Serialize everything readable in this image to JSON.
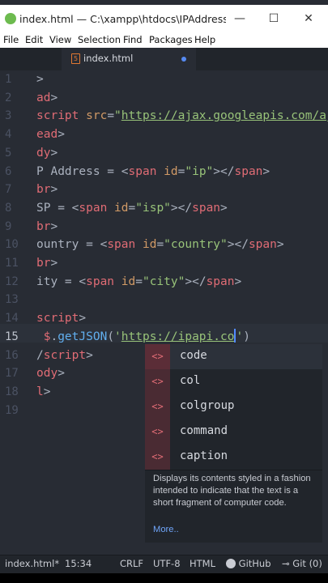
{
  "window": {
    "title": "index.html — C:\\xampp\\htdocs\\IPAddress — Ato",
    "minimize": "—",
    "maximize": "☐",
    "close": "✕"
  },
  "menu": [
    "File",
    "Edit",
    "View",
    "Selection",
    "Find",
    "Packages",
    "Help"
  ],
  "tab": {
    "label": "index.html",
    "icon": "html-file-icon",
    "modified_dot_color": "#568af2"
  },
  "editor": {
    "active_line": 15,
    "line_numbers": [
      "1",
      "2",
      "3",
      "4",
      "5",
      "6",
      "7",
      "8",
      "9",
      "10",
      "11",
      "12",
      "13",
      "14",
      "15",
      "16",
      "17",
      "18",
      "19"
    ],
    "lines": [
      [
        {
          "c": "p",
          "t": ">"
        }
      ],
      [
        {
          "c": "t",
          "t": "ad"
        },
        {
          "c": "p",
          "t": ">"
        }
      ],
      [
        {
          "c": "t",
          "t": "script "
        },
        {
          "c": "a",
          "t": "src"
        },
        {
          "c": "p",
          "t": "="
        },
        {
          "c": "s",
          "t": "\""
        },
        {
          "c": "u",
          "t": "https://ajax.googleapis.com/aj"
        }
      ],
      [
        {
          "c": "t",
          "t": "ead"
        },
        {
          "c": "p",
          "t": ">"
        }
      ],
      [
        {
          "c": "t",
          "t": "dy"
        },
        {
          "c": "p",
          "t": ">"
        }
      ],
      [
        {
          "c": "p",
          "t": "P Address = <"
        },
        {
          "c": "t",
          "t": "span "
        },
        {
          "c": "a",
          "t": "id"
        },
        {
          "c": "p",
          "t": "="
        },
        {
          "c": "s",
          "t": "\"ip\""
        },
        {
          "c": "p",
          "t": "></"
        },
        {
          "c": "t",
          "t": "span"
        },
        {
          "c": "p",
          "t": ">"
        }
      ],
      [
        {
          "c": "t",
          "t": "br"
        },
        {
          "c": "p",
          "t": ">"
        }
      ],
      [
        {
          "c": "p",
          "t": "SP = <"
        },
        {
          "c": "t",
          "t": "span "
        },
        {
          "c": "a",
          "t": "id"
        },
        {
          "c": "p",
          "t": "="
        },
        {
          "c": "s",
          "t": "\"isp\""
        },
        {
          "c": "p",
          "t": "></"
        },
        {
          "c": "t",
          "t": "span"
        },
        {
          "c": "p",
          "t": ">"
        }
      ],
      [
        {
          "c": "t",
          "t": "br"
        },
        {
          "c": "p",
          "t": ">"
        }
      ],
      [
        {
          "c": "p",
          "t": "ountry = <"
        },
        {
          "c": "t",
          "t": "span "
        },
        {
          "c": "a",
          "t": "id"
        },
        {
          "c": "p",
          "t": "="
        },
        {
          "c": "s",
          "t": "\"country\""
        },
        {
          "c": "p",
          "t": "></"
        },
        {
          "c": "t",
          "t": "span"
        },
        {
          "c": "p",
          "t": ">"
        }
      ],
      [
        {
          "c": "t",
          "t": "br"
        },
        {
          "c": "p",
          "t": ">"
        }
      ],
      [
        {
          "c": "p",
          "t": "ity = <"
        },
        {
          "c": "t",
          "t": "span "
        },
        {
          "c": "a",
          "t": "id"
        },
        {
          "c": "p",
          "t": "="
        },
        {
          "c": "s",
          "t": "\"city\""
        },
        {
          "c": "p",
          "t": "></"
        },
        {
          "c": "t",
          "t": "span"
        },
        {
          "c": "p",
          "t": ">"
        }
      ],
      [],
      [
        {
          "c": "t",
          "t": "script"
        },
        {
          "c": "p",
          "t": ">"
        }
      ],
      [
        {
          "c": "p",
          "t": " "
        },
        {
          "c": "v",
          "t": "$"
        },
        {
          "c": "p",
          "t": "."
        },
        {
          "c": "fn",
          "t": "getJSON"
        },
        {
          "c": "p",
          "t": "("
        },
        {
          "c": "s",
          "t": "'"
        },
        {
          "c": "u",
          "t": "https://ipapi.co"
        },
        {
          "c": "caret",
          "t": ""
        },
        {
          "c": "s",
          "t": "'"
        },
        {
          "c": "p",
          "t": ")"
        }
      ],
      [
        {
          "c": "p",
          "t": "/"
        },
        {
          "c": "t",
          "t": "script"
        },
        {
          "c": "p",
          "t": ">"
        }
      ],
      [
        {
          "c": "t",
          "t": "ody"
        },
        {
          "c": "p",
          "t": ">"
        }
      ],
      [
        {
          "c": "t",
          "t": "l"
        },
        {
          "c": "p",
          "t": ">"
        }
      ],
      []
    ]
  },
  "autocomplete": {
    "items": [
      {
        "icon": "<>",
        "label": "code",
        "selected": true
      },
      {
        "icon": "<>",
        "label": "col",
        "selected": false
      },
      {
        "icon": "<>",
        "label": "colgroup",
        "selected": false
      },
      {
        "icon": "<>",
        "label": "command",
        "selected": false
      },
      {
        "icon": "<>",
        "label": "caption",
        "selected": false
      }
    ],
    "description": "Displays its contents styled in a fashion intended to indicate that the text is a short fragment of computer code.",
    "more": "More.."
  },
  "statusbar": {
    "file": "index.html*",
    "cursor": "15:34",
    "line_ending": "CRLF",
    "encoding": "UTF-8",
    "grammar": "HTML",
    "github": "GitHub",
    "git": "Git (0)"
  },
  "colors": {
    "editor_bg": "#282c34",
    "tag": "#e06c75",
    "attr": "#d19a66",
    "string": "#98c379",
    "function": "#61afef"
  }
}
